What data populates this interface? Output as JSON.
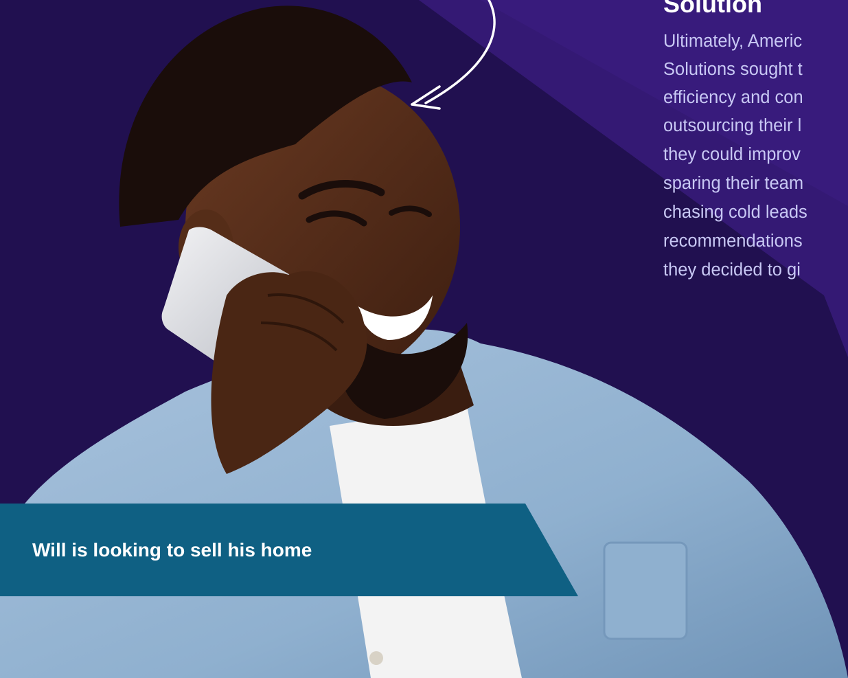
{
  "solution": {
    "heading": "Solution",
    "lines": [
      "Ultimately, Americ",
      "Solutions sought t",
      "efficiency and con",
      "outsourcing their l",
      "they could improv",
      "sparing their team",
      "chasing cold leads",
      "recommendations",
      "they decided to gi"
    ]
  },
  "caption": {
    "text": "Will is looking to sell his home"
  },
  "colors": {
    "background": "#211050",
    "accent_purple": "#3b1c80",
    "caption_bg": "#0f6083",
    "heading": "#ffffff",
    "body_text": "#c8c8f4"
  }
}
